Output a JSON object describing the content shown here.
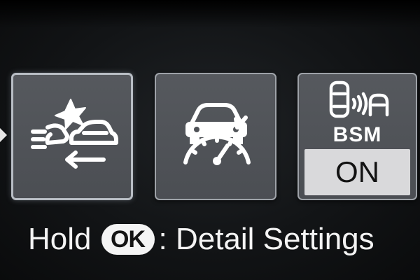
{
  "menu": {
    "tiles": [
      {
        "id": "pcs",
        "icon": "pre-collision-warning-icon",
        "selected": true
      },
      {
        "id": "drcc",
        "icon": "radar-cruise-distance-icon",
        "selected": false
      },
      {
        "id": "bsm",
        "icon": "blind-spot-monitor-icon",
        "label": "BSM",
        "status": "ON",
        "selected": false
      }
    ]
  },
  "hint": {
    "prefix": "Hold",
    "button": "OK",
    "suffix": ": Detail Settings"
  },
  "colors": {
    "tile_fill": "#4f5257",
    "tile_border": "#9ea2a8",
    "status_box": "#d9d9db",
    "text": "#f4f4f4"
  }
}
